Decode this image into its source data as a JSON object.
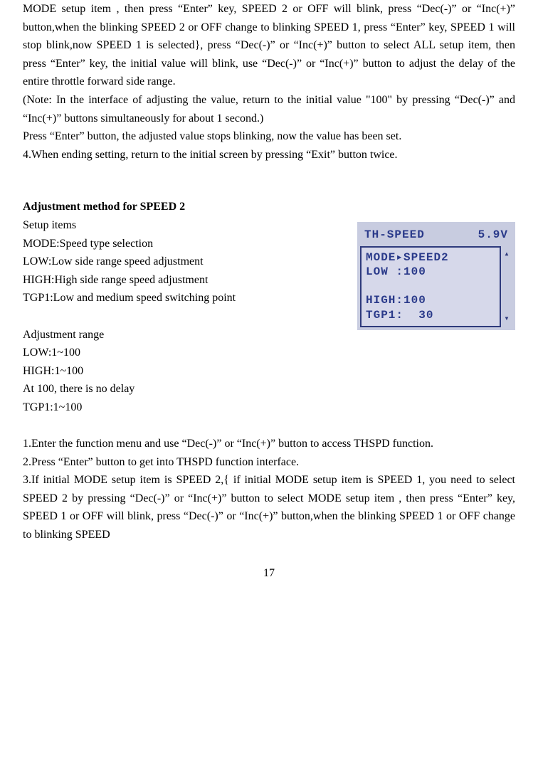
{
  "p1": "MODE setup item , then press “Enter” key, SPEED 2 or OFF will blink, press “Dec(-)” or “Inc(+)” button,when the blinking SPEED 2 or OFF change to blinking SPEED 1, press “Enter” key, SPEED 1 will stop blink,now SPEED 1 is selected}, press “Dec(-)” or “Inc(+)” button to select ALL setup item, then press “Enter” key, the initial value will blink,   use “Dec(-)” or “Inc(+)” button to adjust the delay of the entire throttle forward side range.",
  "p2": "(Note: In the interface of adjusting the value, return to the initial value \"100\" by pressing “Dec(-)” and “Inc(+)” buttons simultaneously for about 1 second.)",
  "p3": "Press   “Enter” button, the adjusted value stops blinking, now the value has been set.",
  "p4": "4.When ending setting, return to the initial screen by pressing “Exit” button twice.",
  "section_title": "Adjustment method for SPEED 2",
  "setup_heading": "Setup items",
  "setup_mode": "MODE:Speed type selection",
  "setup_low": "LOW:Low side range speed adjustment",
  "setup_high": "HIGH:High side range speed adjustment",
  "setup_tgp1": "TGP1:Low and medium speed switching point",
  "adj_heading": "Adjustment range",
  "adj_low": "LOW:1~100",
  "adj_high": "HIGH:1~100",
  "adj_note": "At 100, there is no delay",
  "adj_tgp1": "TGP1:1~100",
  "step1": "1.Enter the function menu and use   “Dec(-)” or “Inc(+)” button to access THSPD function.",
  "step2": "2.Press “Enter” button to get into THSPD function interface.",
  "step3": "3.If initial MODE setup item is SPEED 2,{ if initial MODE setup item is SPEED 1, you need to select SPEED 2 by pressing “Dec(-)” or “Inc(+)” button to select MODE setup item , then press “Enter” key, SPEED 1 or OFF will blink, press “Dec(-)” or “Inc(+)” button,when the blinking SPEED 1 or OFF change to blinking SPEED",
  "lcd": {
    "title": "TH-SPEED",
    "voltage": "5.9V",
    "line1": "MODE▸SPEED2",
    "line2": "LOW :100",
    "line3": "HIGH:100",
    "line4": "TGP1:  30"
  },
  "page_number": "17"
}
